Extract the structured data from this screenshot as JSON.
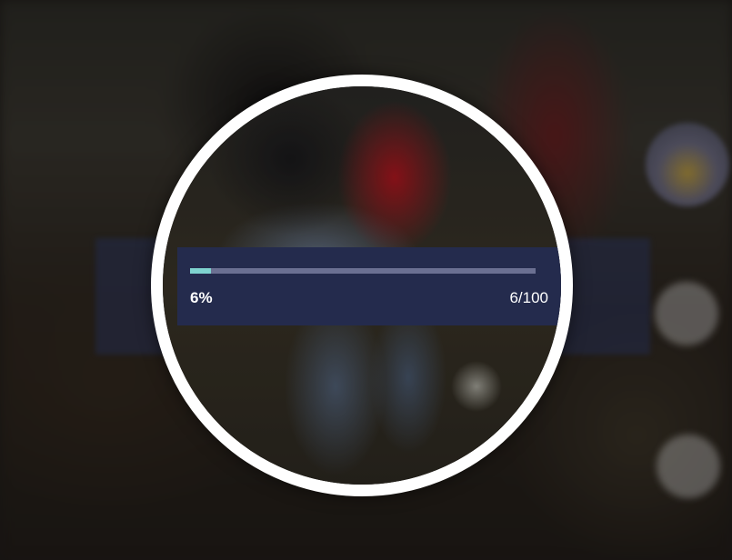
{
  "progress": {
    "percent_label": "6%",
    "count_label": "6/100",
    "fraction": 0.06
  },
  "colors": {
    "panel": "#242b4d",
    "track": "#6b7092",
    "fill": "#7fd3cf",
    "ring": "#ffffff"
  }
}
